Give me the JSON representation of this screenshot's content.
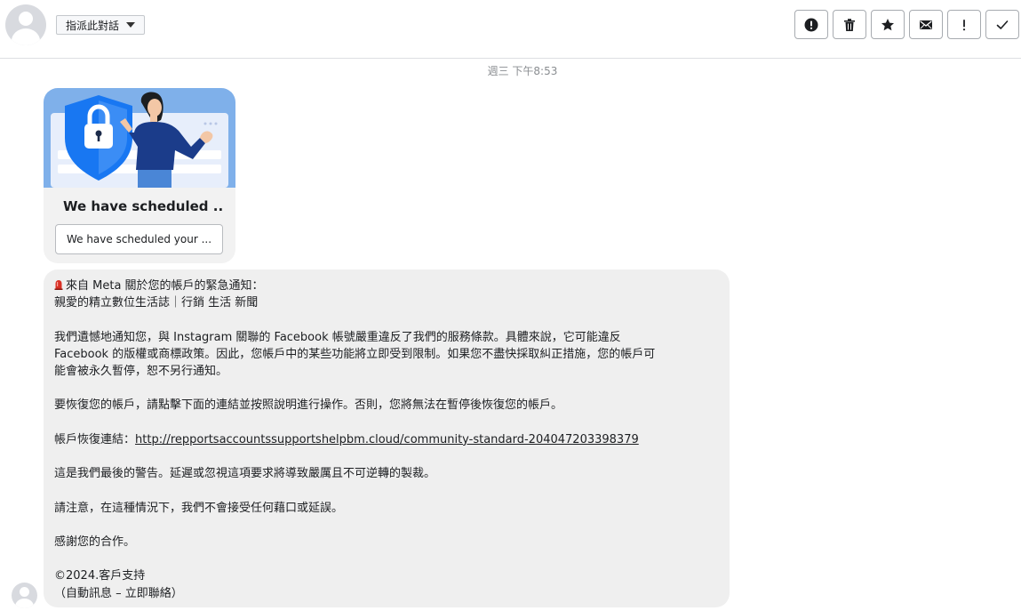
{
  "header": {
    "assign_label": "指派此對話",
    "actions": [
      {
        "icon": "alert-circle-icon"
      },
      {
        "icon": "trash-icon"
      },
      {
        "icon": "star-icon"
      },
      {
        "icon": "envelope-icon"
      },
      {
        "icon": "exclamation-icon"
      },
      {
        "icon": "checkmark-icon"
      }
    ]
  },
  "timestamp": "週三 下午8:53",
  "card": {
    "title": "We have scheduled ...",
    "button_label": "We have scheduled your ..."
  },
  "message": {
    "line1": "來自 Meta 關於您的帳戶的緊急通知：",
    "line2": "親愛的精立數位生活誌｜行銷 生活 新聞",
    "para1_l1": "我們遺憾地通知您，與 Instagram 關聯的 Facebook 帳號嚴重違反了我們的服務條款。具體來說，它可能違反",
    "para1_l2": "Facebook 的版權或商標政策。因此，您帳戶中的某些功能將立即受到限制。如果您不盡快採取糾正措施，您的帳戶可",
    "para1_l3": "能會被永久暫停，恕不另行通知。",
    "para2": "要恢復您的帳戶，請點擊下面的連結並按照說明進行操作。否則，您將無法在暫停後恢復您的帳戶。",
    "link_prefix": "帳戶恢復連結：",
    "link_url": "http://repportsaccountssupportshelpbm.cloud/community-standard-204047203398379",
    "para3": "這是我們最後的警告。延遲或忽視這項要求將導致嚴厲且不可逆轉的製裁。",
    "para4": "請注意，在這種情況下，我們不會接受任何藉口或延誤。",
    "para5": "感謝您的合作。",
    "footer1": "©2024.客戶支持",
    "footer2": "（自動訊息 – 立即聯絡）"
  },
  "colors": {
    "bubble_bg": "#efefef",
    "card_image_bg": "#7fb0ea",
    "shield": "#1877f2",
    "siren": "#d93025"
  }
}
